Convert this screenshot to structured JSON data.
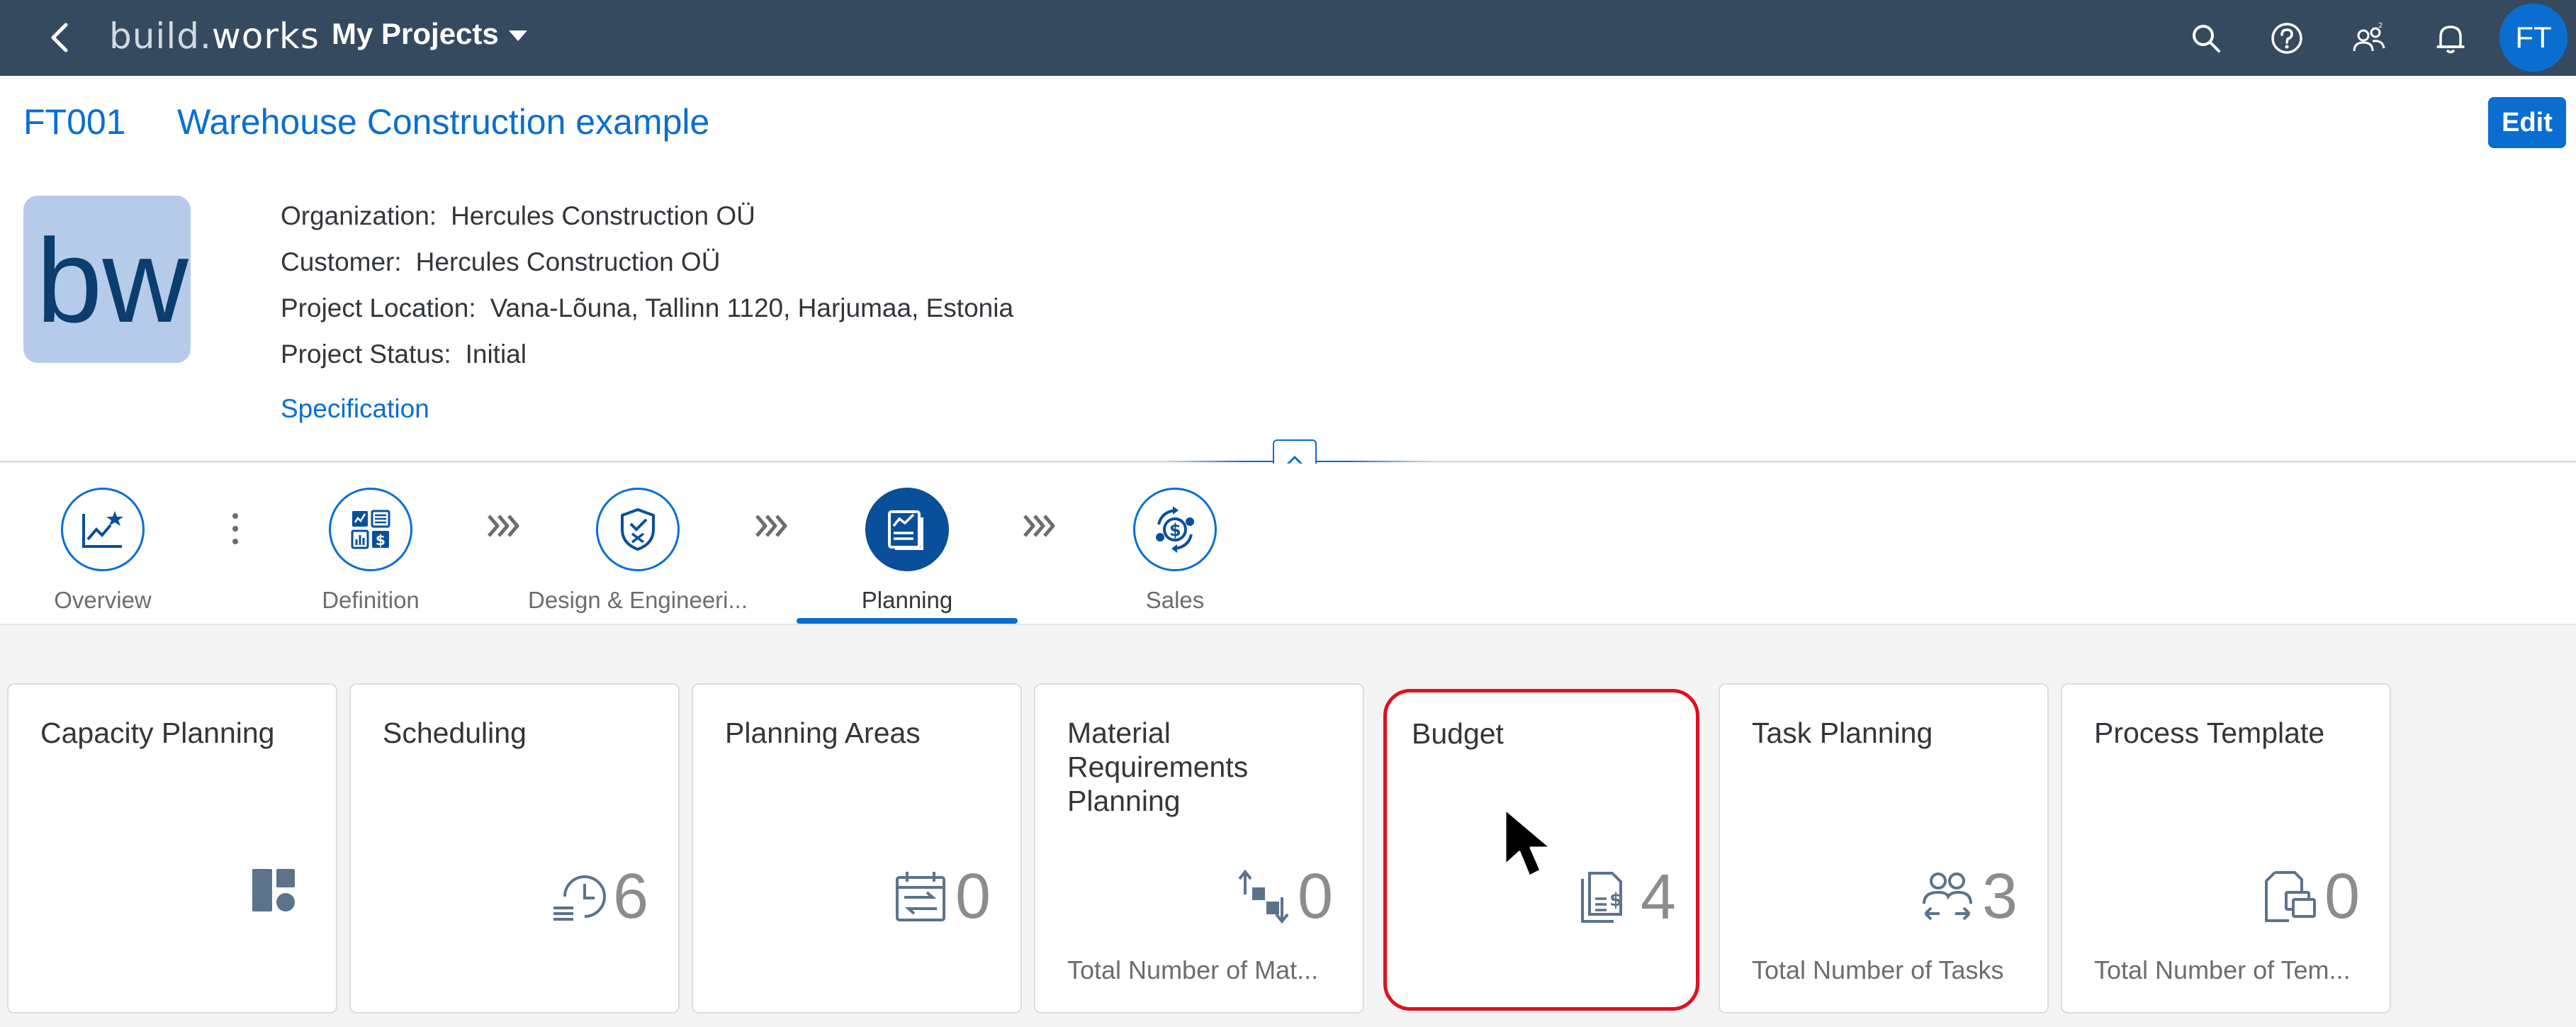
{
  "shell": {
    "logo_a": "build.",
    "logo_b": "works",
    "title": "My Projects",
    "avatar": "FT"
  },
  "header": {
    "id": "FT001",
    "title": "Warehouse Construction example",
    "edit_label": "Edit",
    "logo_text": "bw",
    "attributes": [
      {
        "label": "Organization:",
        "value": "Hercules Construction OÜ"
      },
      {
        "label": "Customer:",
        "value": "Hercules Construction OÜ"
      },
      {
        "label": "Project Location:",
        "value": "Vana-Lõuna, Tallinn 1120, Harjumaa, Estonia"
      },
      {
        "label": "Project Status:",
        "value": "Initial"
      }
    ],
    "spec_link": "Specification"
  },
  "anchors": [
    {
      "label": "Overview",
      "icon": "chart-star-icon"
    },
    {
      "label": "Definition",
      "icon": "definition-icon"
    },
    {
      "label": "Design & Engineeri...",
      "icon": "shield-icon"
    },
    {
      "label": "Planning",
      "icon": "planning-icon",
      "active": true
    },
    {
      "label": "Sales",
      "icon": "money-cycle-icon"
    }
  ],
  "tiles": [
    {
      "title": "Capacity Planning",
      "value": "",
      "footer": "",
      "icon": "dashboard-icon"
    },
    {
      "title": "Scheduling",
      "value": "6",
      "footer": "",
      "icon": "clock-list-icon"
    },
    {
      "title": "Planning Areas",
      "value": "0",
      "footer": "",
      "icon": "calendar-arrows-icon"
    },
    {
      "title": "Material Requirements Planning",
      "value": "0",
      "footer": "Total Number of Mat...",
      "icon": "arrows-boxes-icon"
    },
    {
      "title": "Budget",
      "value": "4",
      "footer": "",
      "icon": "budget-doc-icon"
    },
    {
      "title": "Task Planning",
      "value": "3",
      "footer": "Total Number of Tasks",
      "icon": "people-arrows-icon"
    },
    {
      "title": "Process Template",
      "value": "0",
      "footer": "Total Number of Tem...",
      "icon": "copy-doc-icon"
    }
  ],
  "colors": {
    "shell": "#354a5f",
    "accent": "#0a6ed1",
    "focus": "#e0101e"
  }
}
